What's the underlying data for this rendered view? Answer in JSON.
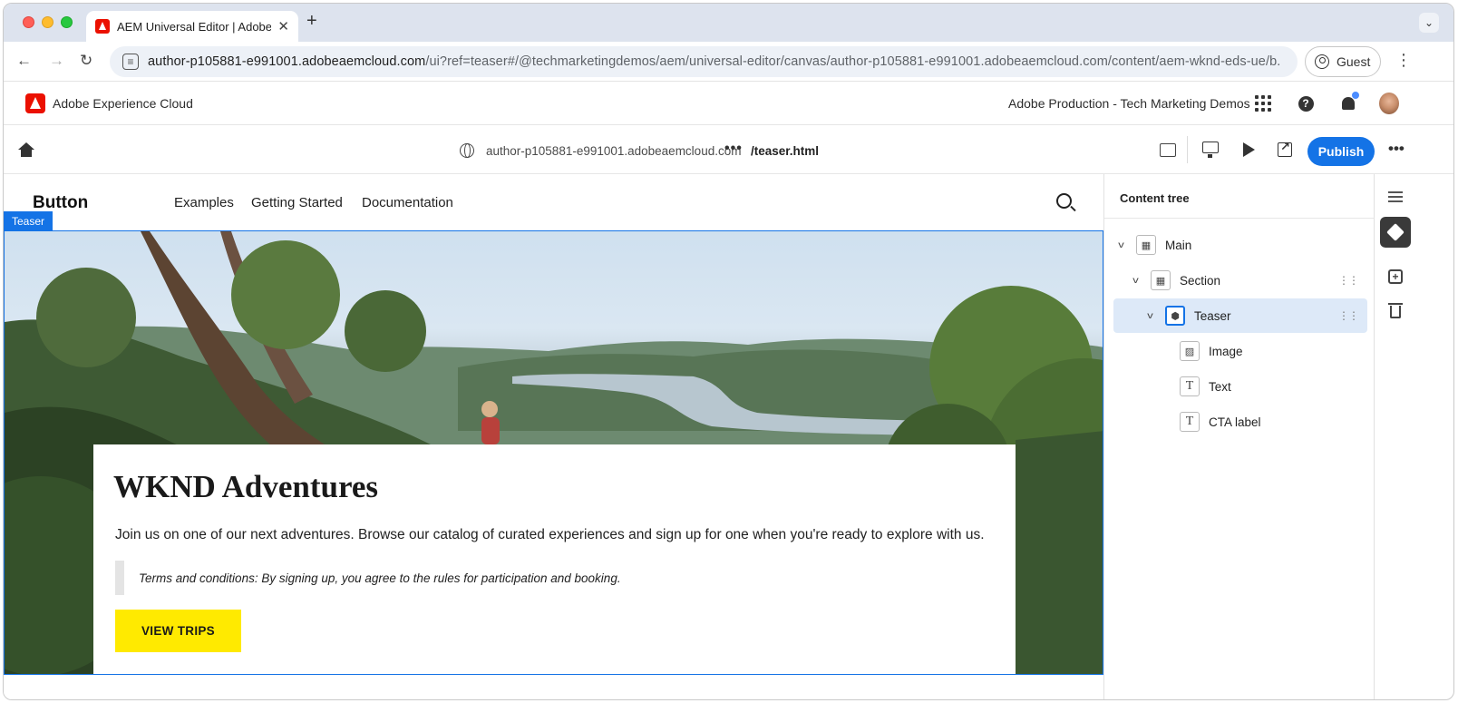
{
  "browser": {
    "tab_title": "AEM Universal Editor | Adobe",
    "new_tab": "+",
    "tab_close": "✕",
    "url_main": "author-p105881-e991001.adobeaemcloud.com",
    "url_rest": "/ui?ref=teaser#/@techmarketingdemos/aem/universal-editor/canvas/author-p105881-e991001.adobeaemcloud.com/content/aem-wknd-eds-ue/b...",
    "profile_label": "Guest"
  },
  "shell": {
    "app_name": "Adobe Experience Cloud",
    "org_name": "Adobe Production - Tech Marketing Demos",
    "help_glyph": "?"
  },
  "editor": {
    "host": "author-p105881-e991001.adobeaemcloud.com",
    "more": "•••",
    "page_path": "/teaser.html",
    "publish_label": "Publish",
    "menu": "•••"
  },
  "site": {
    "brand": "Button",
    "nav": [
      "Examples",
      "Getting Started",
      "Documentation"
    ],
    "selected_tag": "Teaser"
  },
  "teaser": {
    "title": "WKND Adventures",
    "body": "Join us on one of our next adventures. Browse our catalog of curated experiences and sign up for one when you're ready to explore with us.",
    "terms": "Terms and conditions: By signing up, you agree to the rules for participation and booking.",
    "cta": "VIEW TRIPS"
  },
  "content_tree": {
    "heading": "Content tree",
    "nodes": [
      {
        "label": "Main",
        "icon": "block-icon"
      },
      {
        "label": "Section",
        "icon": "block-icon"
      },
      {
        "label": "Teaser",
        "icon": "component-icon",
        "selected": true
      },
      {
        "label": "Image",
        "icon": "image-icon"
      },
      {
        "label": "Text",
        "icon": "text-icon"
      },
      {
        "label": "CTA label",
        "icon": "text-icon"
      }
    ],
    "glyphs": {
      "text": "T",
      "chevron": "v",
      "drag": "⋮⋮"
    }
  },
  "rail": {
    "add_glyph": "+"
  },
  "colors": {
    "accent": "#1473e6",
    "cta": "#ffea00",
    "adobe_red": "#eb1000",
    "selected_row": "#dde9f8"
  }
}
